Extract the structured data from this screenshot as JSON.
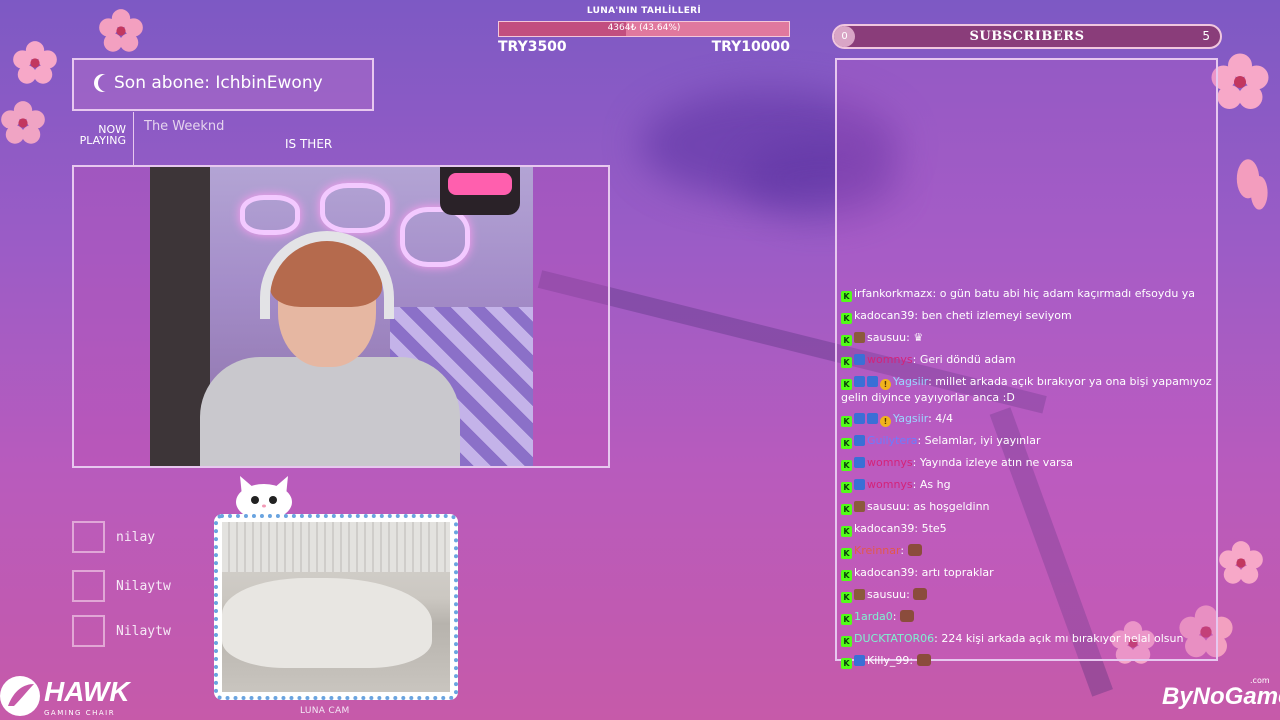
{
  "goal": {
    "title": "LUNA'NIN TAHLİLLERİ",
    "progress_text": "4364₺ (43.64%)",
    "progress_fraction": 0.4364,
    "min": "TRY3500",
    "max": "TRY10000"
  },
  "subscribers": {
    "start": "0",
    "label": "SUBSCRIBERS",
    "goal": "5"
  },
  "last_sub": {
    "text": "Son abone: IchbinEwony"
  },
  "now_playing": {
    "label": "NOW PLAYING",
    "artist": "The Weeknd",
    "track": "IS THER"
  },
  "followers": [
    "nilay",
    "Nilaytw",
    "Nilaytw"
  ],
  "luna_cam": {
    "label": "LUNA CAM"
  },
  "chat": [
    {
      "badges": [
        "k"
      ],
      "user": "irfankorkmazx",
      "color": "#ffffff",
      "text": ": o gün batu abi hiç adam kaçırmadı efsoydu ya"
    },
    {
      "badges": [
        "k"
      ],
      "user": "kadocan39",
      "color": "#ffffff",
      "text": ": ben cheti izlemeyi seviyom"
    },
    {
      "badges": [
        "k",
        "gift"
      ],
      "user": "sausuu",
      "color": "#ffffff",
      "text": ": ♛"
    },
    {
      "badges": [
        "k",
        "sub"
      ],
      "user": "womnys",
      "color": "#d4237a",
      "text": ": Geri döndü adam"
    },
    {
      "badges": [
        "k",
        "sub",
        "sub",
        "vip"
      ],
      "user": "Yagsiir",
      "color": "#9ad6ff",
      "text": ": millet arkada açık bırakıyor ya ona bişi yapamıyoz gelin diyince yayıyorlar anca :D"
    },
    {
      "badges": [
        "k",
        "sub",
        "sub",
        "vip"
      ],
      "user": "Yagsiir",
      "color": "#9ad6ff",
      "text": ": 4/4"
    },
    {
      "badges": [
        "k",
        "sub"
      ],
      "user": "Guilytera",
      "color": "#6b7cff",
      "text": ": Selamlar, iyi yayınlar"
    },
    {
      "badges": [
        "k",
        "sub"
      ],
      "user": "womnys",
      "color": "#d4237a",
      "text": ": Yayında izleye atın ne varsa"
    },
    {
      "badges": [
        "k",
        "sub"
      ],
      "user": "womnys",
      "color": "#d4237a",
      "text": ": As hg"
    },
    {
      "badges": [
        "k",
        "gift"
      ],
      "user": "sausuu",
      "color": "#ffffff",
      "text": ": as hoşgeldinn"
    },
    {
      "badges": [
        "k"
      ],
      "user": "kadocan39",
      "color": "#ffffff",
      "text": ": 5te5"
    },
    {
      "badges": [
        "k"
      ],
      "user": "Kreinnar",
      "color": "#e2594c",
      "text": ": ",
      "emote": true
    },
    {
      "badges": [
        "k"
      ],
      "user": "kadocan39",
      "color": "#ffffff",
      "text": ": artı topraklar"
    },
    {
      "badges": [
        "k",
        "gift"
      ],
      "user": "sausuu",
      "color": "#ffffff",
      "text": ": ",
      "emote": true
    },
    {
      "badges": [
        "k"
      ],
      "user": "1arda0",
      "color": "#7ef2d0",
      "text": ": ",
      "emote": true
    },
    {
      "badges": [
        "k"
      ],
      "user": "DUCKTATOR06",
      "color": "#7ef2d0",
      "text": ": 224 kişi arkada açık mı bırakıyor helal olsun"
    },
    {
      "badges": [
        "k",
        "sub"
      ],
      "user": "Killy_99",
      "color": "#ffffff",
      "text": ": ",
      "emote": true
    }
  ],
  "brands": {
    "left_logo": "HAWK",
    "left_logo_sub": "GAMING CHAIR",
    "right_logo": "ByNoGame",
    "right_logo_sub": ".com"
  },
  "colors": {
    "accent_pink": "#c24e7f",
    "frame": "#e7c8ef",
    "kick_green": "#53fc18"
  }
}
